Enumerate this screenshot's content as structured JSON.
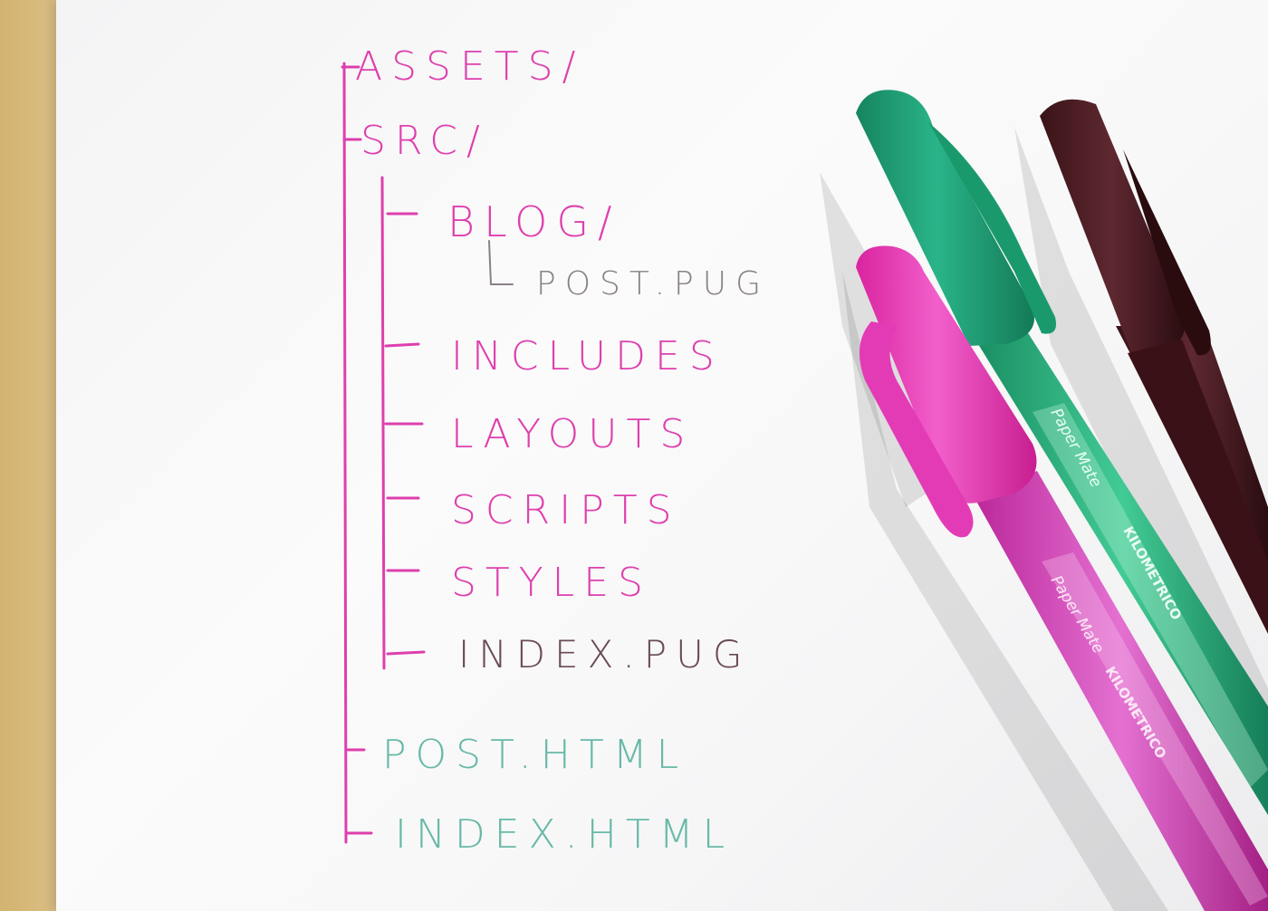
{
  "tree": {
    "assets": "ASSETS/",
    "src": "SRC/",
    "blog": "BLOG/",
    "post_pug": "POST.PUG",
    "includes": "INCLUDES",
    "layouts": "LAYOUTS",
    "scripts": "SCRIPTS",
    "styles": "STYLES",
    "index_pug": "INDEX.PUG",
    "post_html": "POST.HTML",
    "index_html": "INDEX.HTML"
  },
  "pens": [
    {
      "name": "pink-pen",
      "brand": "Paper Mate",
      "model": "KILOMETRICO",
      "color": "#e040b5"
    },
    {
      "name": "green-pen",
      "brand": "Paper Mate",
      "model": "KILOMETRICO",
      "color": "#1fa57a"
    },
    {
      "name": "brown-pen",
      "brand": "",
      "model": "",
      "color": "#4a1f25"
    }
  ],
  "colors": {
    "ink_pink": "#de3fae",
    "ink_teal": "#67b9a7",
    "ink_brown": "#6a4a55",
    "pencil_gray": "#8a8088"
  }
}
